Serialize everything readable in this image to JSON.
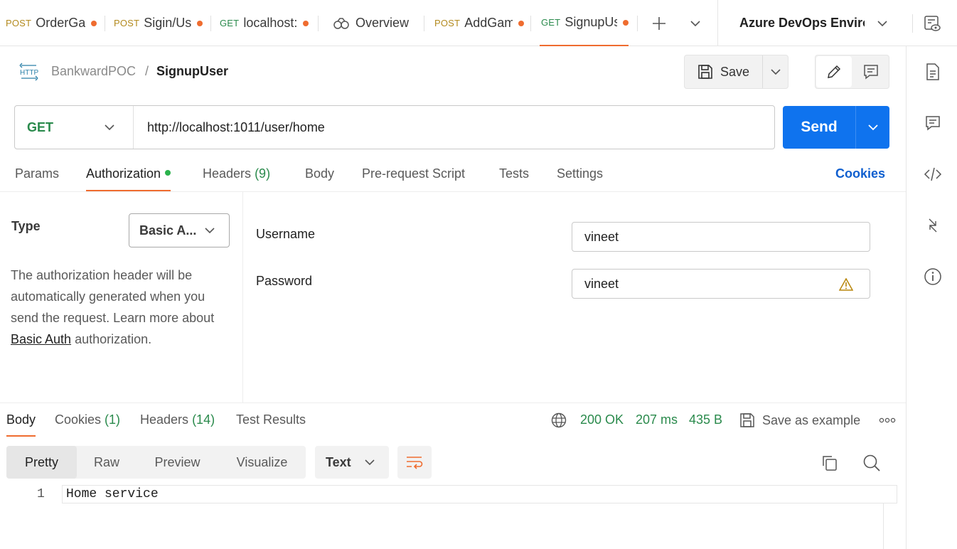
{
  "tabs": [
    {
      "method": "POST",
      "name": "OrderGa",
      "unsaved": true,
      "active": false
    },
    {
      "method": "POST",
      "name": "Sigin/Us",
      "unsaved": true,
      "active": false
    },
    {
      "method": "GET",
      "name": "localhost:",
      "unsaved": true,
      "active": false
    },
    {
      "method": "",
      "name": "Overview",
      "unsaved": false,
      "active": false
    },
    {
      "method": "POST",
      "name": "AddGam",
      "unsaved": true,
      "active": false
    },
    {
      "method": "GET",
      "name": "SignupUs",
      "unsaved": true,
      "active": true
    }
  ],
  "environment": {
    "selected": "Azure DevOps Enviror"
  },
  "breadcrumb": {
    "collection": "BankwardPOC",
    "separator": "/",
    "request": "SignupUser"
  },
  "toolbar": {
    "save_label": "Save"
  },
  "request": {
    "method": "GET",
    "url": "http://localhost:1011/user/home",
    "send_label": "Send"
  },
  "request_tabs": {
    "params": "Params",
    "authorization": "Authorization",
    "headers": "Headers",
    "headers_count": "(9)",
    "body": "Body",
    "prerequest": "Pre-request Script",
    "tests": "Tests",
    "settings": "Settings",
    "cookies": "Cookies"
  },
  "auth": {
    "type_label": "Type",
    "type_value": "Basic A...",
    "description": "The authorization header will be automatically generated when you send the request. Learn more about",
    "link_text": "Basic Auth",
    "description_end": "authorization.",
    "username_label": "Username",
    "username_value": "vineet",
    "password_label": "Password",
    "password_value": "vineet"
  },
  "response": {
    "tabs": {
      "body": "Body",
      "cookies": "Cookies",
      "cookies_count": "(1)",
      "headers": "Headers",
      "headers_count": "(14)",
      "test_results": "Test Results"
    },
    "status": "200 OK",
    "time": "207 ms",
    "size": "435 B",
    "save_example": "Save as example",
    "view_modes": [
      "Pretty",
      "Raw",
      "Preview",
      "Visualize"
    ],
    "format": "Text",
    "lines": [
      {
        "number": "1",
        "text": "Home service"
      }
    ]
  },
  "colors": {
    "accent": "#ef6c2f",
    "send": "#0f73ee",
    "success": "#2a8a4c",
    "post": "#b38a1e",
    "link": "#0f5fcf"
  }
}
